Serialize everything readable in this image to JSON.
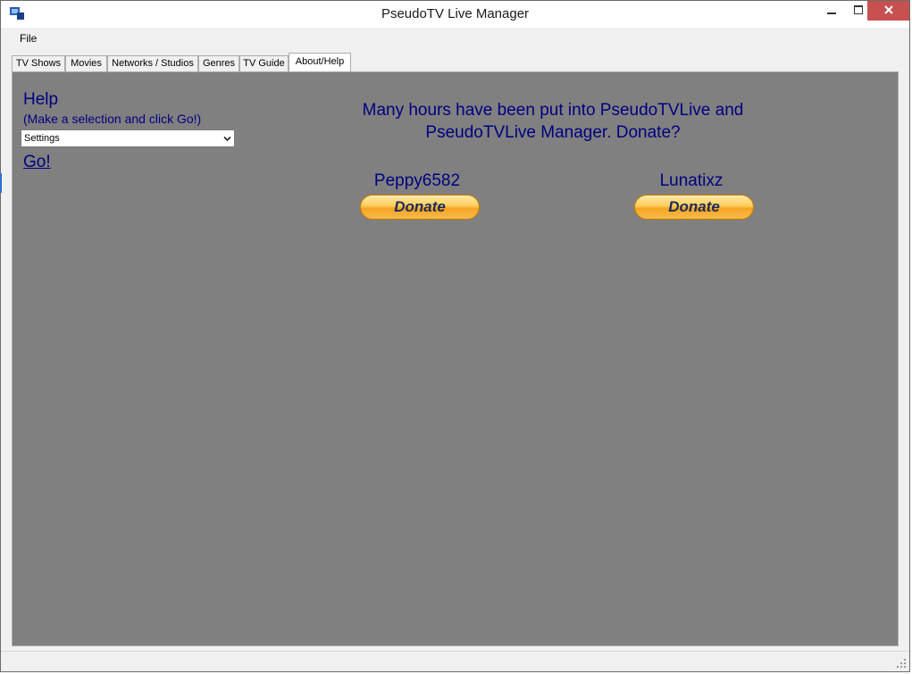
{
  "window": {
    "title": "PseudoTV Live Manager"
  },
  "menu": {
    "file": "File"
  },
  "tabs": [
    {
      "label": "TV Shows"
    },
    {
      "label": "Movies"
    },
    {
      "label": "Networks / Studios"
    },
    {
      "label": "Genres"
    },
    {
      "label": "TV Guide"
    },
    {
      "label": "About/Help",
      "active": true
    }
  ],
  "help": {
    "title": "Help",
    "subtitle": "(Make a selection and click Go!)",
    "select_value": "Settings",
    "go_label": "Go!"
  },
  "donate": {
    "headline_line1": "Many hours have been put into PseudoTVLive and",
    "headline_line2": "PseudoTVLive Manager. Donate?",
    "donors": [
      {
        "name": "Peppy6582",
        "button": "Donate"
      },
      {
        "name": "Lunatixz",
        "button": "Donate"
      }
    ]
  },
  "colors": {
    "panel_bg": "#808080",
    "text_navy": "#000080",
    "close_button": "#c75050",
    "donate_orange": "#f5a623"
  },
  "icons": {
    "app": "app-icon",
    "minimize": "minimize-icon",
    "maximize": "maximize-icon",
    "close": "close-icon",
    "dropdown": "chevron-down-icon",
    "resize": "resize-grip-icon"
  }
}
